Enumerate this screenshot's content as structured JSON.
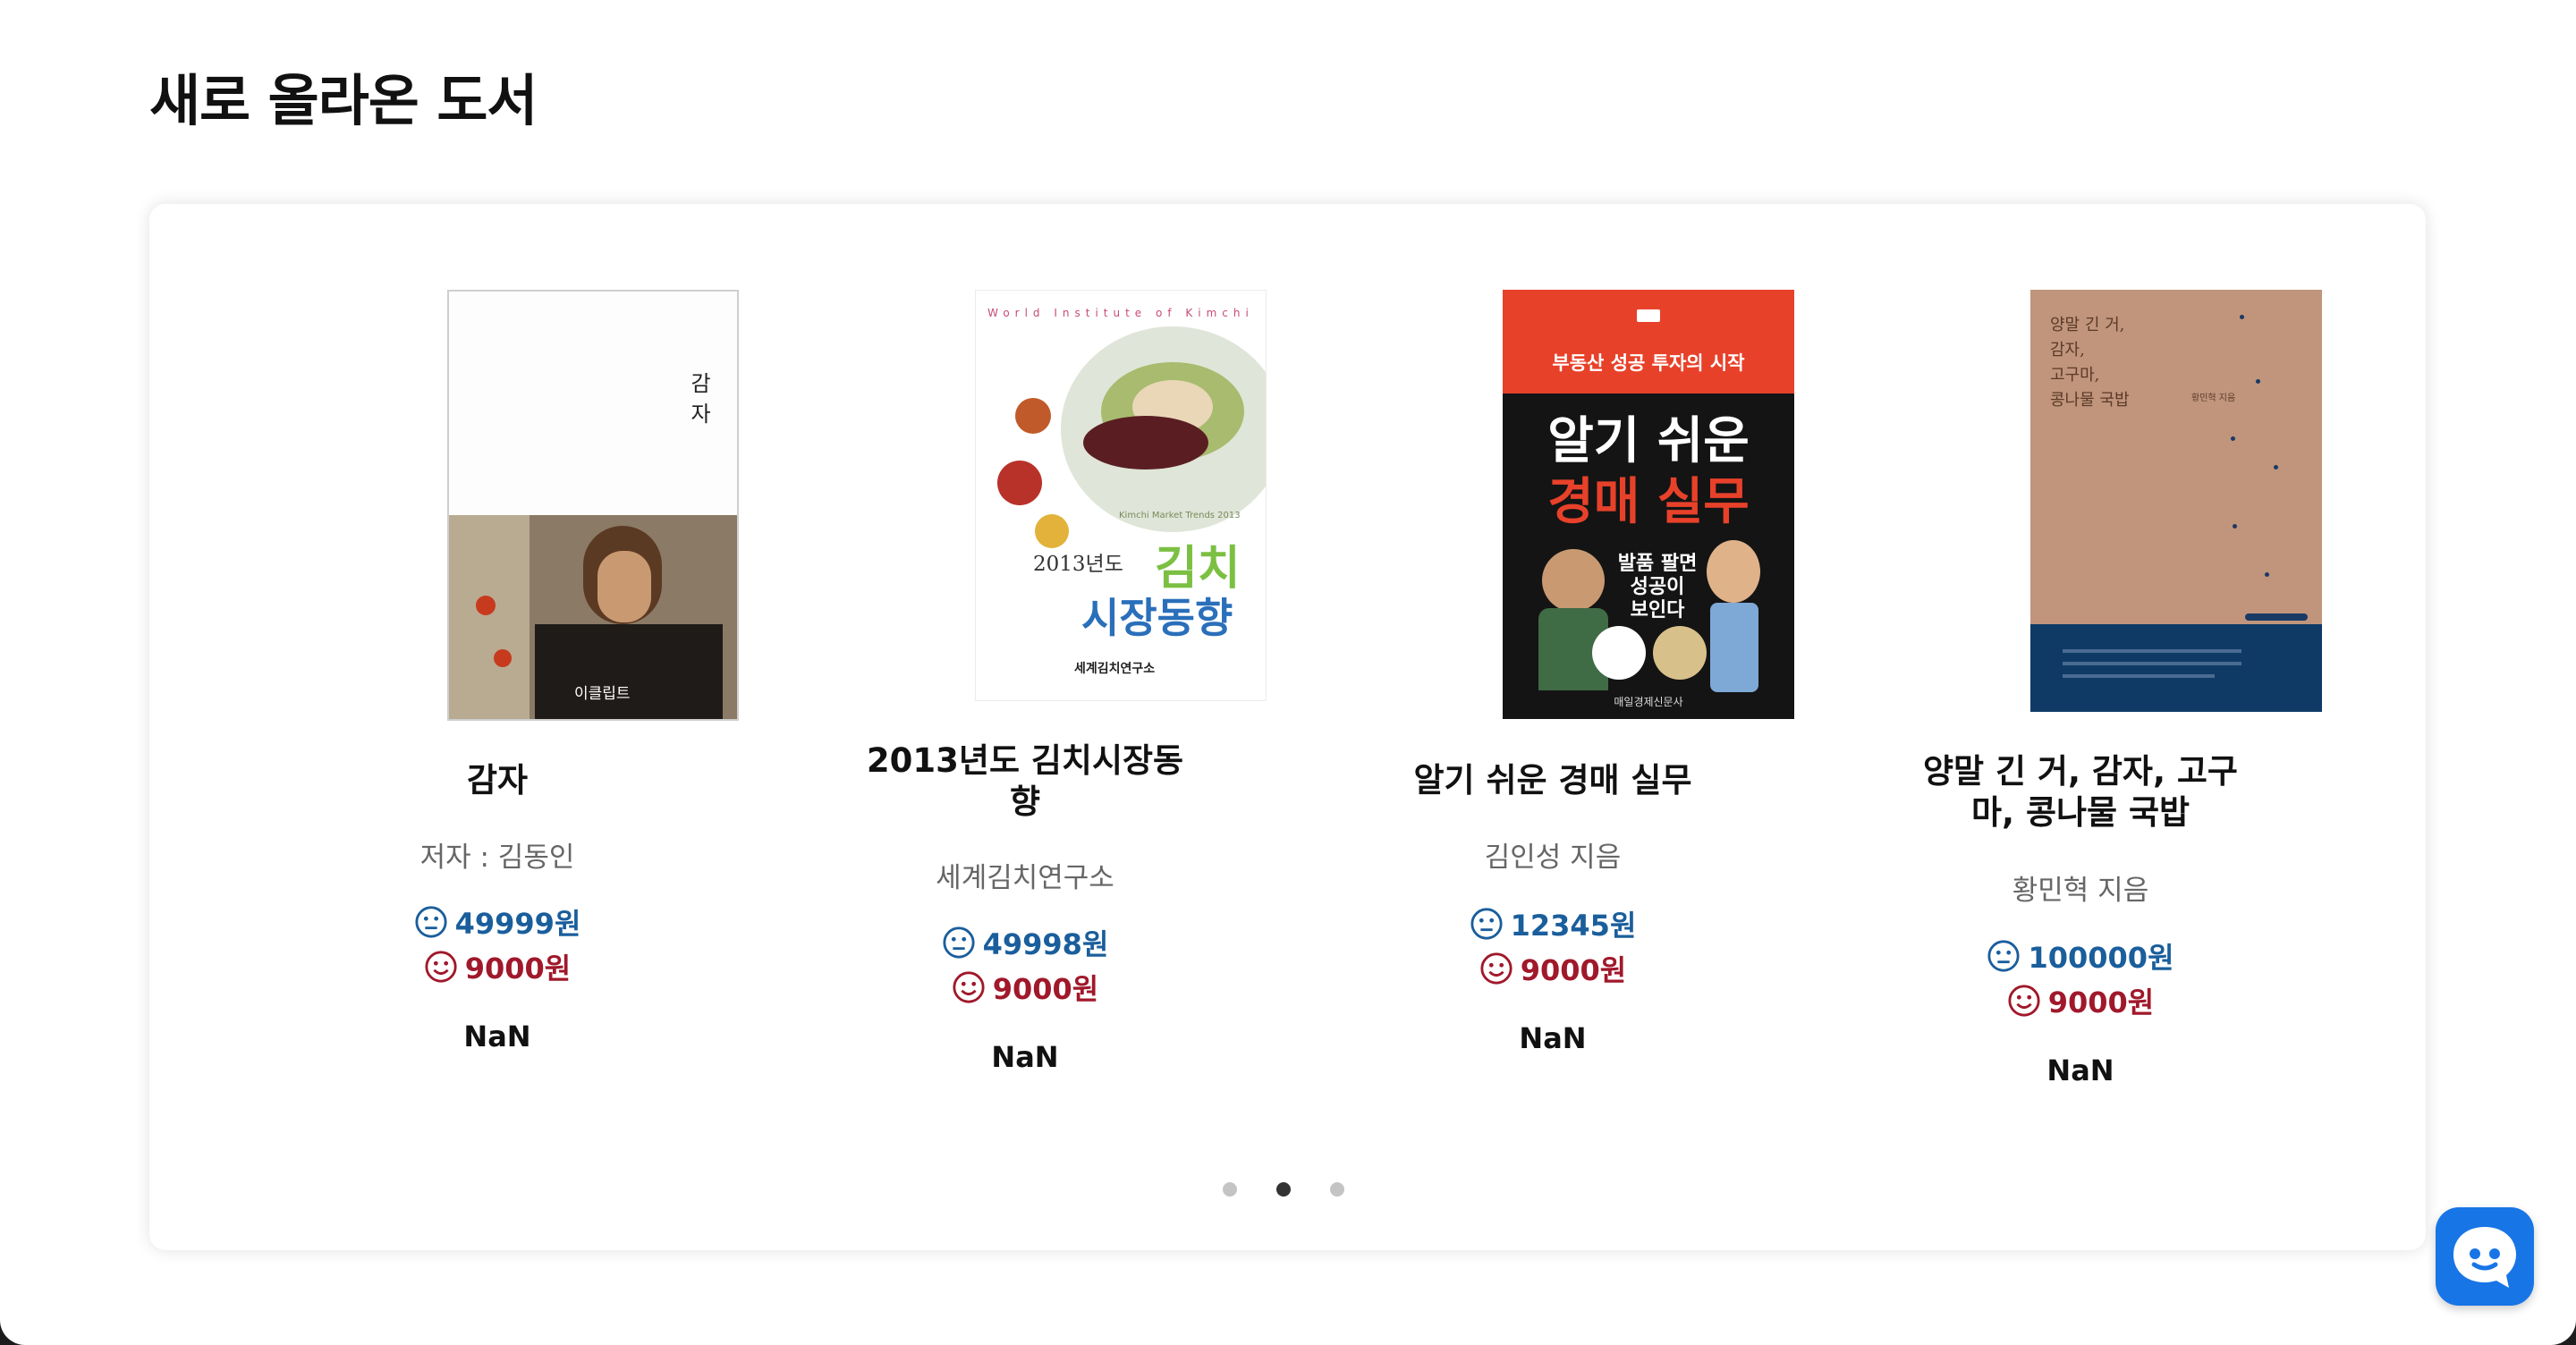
{
  "section": {
    "title": "새로 올라온 도서"
  },
  "books": [
    {
      "title": "감자",
      "author": "저자 : 김동인",
      "list_price": "49999원",
      "sale_price": "9000원",
      "rating": "NaN",
      "cover": {
        "title_text": "감자",
        "publisher": "이클립트"
      }
    },
    {
      "title": "2013년도 김치시장동향",
      "author": "세계김치연구소",
      "list_price": "49998원",
      "sale_price": "9000원",
      "rating": "NaN",
      "cover": {
        "top_text": "World Institute of Kimchi",
        "sub_text": "Kimchi Market Trends 2013",
        "year_text": "2013년도",
        "title_line1": "김치",
        "title_line2": "시장동향",
        "publisher": "세계김치연구소"
      }
    },
    {
      "title": "알기 쉬운 경매 실무",
      "author": "김인성 지음",
      "list_price": "12345원",
      "sale_price": "9000원",
      "rating": "NaN",
      "cover": {
        "banner": "부동산 성공 투자의 시작",
        "title_line1": "알기 쉬운",
        "title_line2": "경매 실무",
        "bubble_line1": "발품 팔면",
        "bubble_line2": "성공이",
        "bubble_line3": "보인다",
        "publisher": "매일경제신문사"
      }
    },
    {
      "title": "양말 긴 거, 감자, 고구마, 콩나물 국밥",
      "author": "황민혁 지음",
      "list_price": "100000원",
      "sale_price": "9000원",
      "rating": "NaN",
      "cover": {
        "line1": "양말 긴 거,",
        "line2": "감자,",
        "line3": "고구마,",
        "line4": "콩나물 국밥",
        "author_small": "황민혁 지음"
      }
    }
  ],
  "carousel": {
    "page_count": 3,
    "active_index": 1
  },
  "colors": {
    "list_price": "#1a5e9c",
    "sale_price": "#a0182a",
    "chat_button": "#1875e6",
    "auction_cover_red": "#e8412a",
    "socks_cover_tan": "#c0957c",
    "socks_cover_navy": "#0f3a66"
  },
  "icons": {
    "list_price": "neutral-face-icon",
    "sale_price": "smiley-face-icon",
    "chat": "chat-bubble-icon"
  }
}
